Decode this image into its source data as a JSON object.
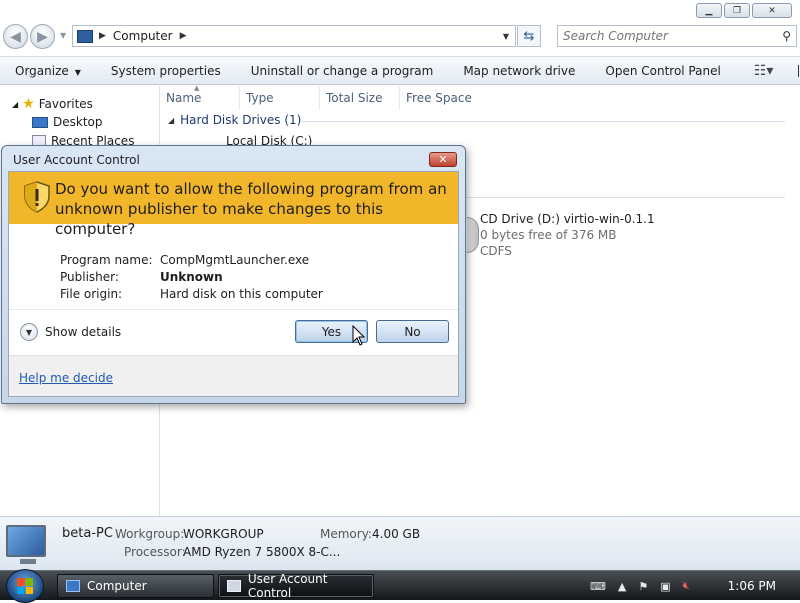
{
  "explorer": {
    "address": {
      "location": "Computer"
    },
    "search": {
      "placeholder": "Search Computer"
    },
    "toolbar": {
      "organize": "Organize",
      "system_properties": "System properties",
      "uninstall": "Uninstall or change a program",
      "map_drive": "Map network drive",
      "control_panel": "Open Control Panel"
    },
    "nav": {
      "favorites": "Favorites",
      "desktop": "Desktop",
      "recent": "Recent Places"
    },
    "columns": [
      "Name",
      "Type",
      "Total Size",
      "Free Space"
    ],
    "groups": {
      "hard_disk": "Hard Disk Drives (1)"
    },
    "local_disk": "Local Disk (C:)",
    "cd_drive": {
      "name": "CD Drive (D:) virtio-win-0.1.1",
      "free": "0 bytes free of 376 MB",
      "filesystem": "CDFS"
    },
    "details": {
      "name": "beta-PC",
      "workgroup_label": "Workgroup:",
      "workgroup": "WORKGROUP",
      "memory_label": "Memory:",
      "memory": "4.00 GB",
      "processor_label": "Processor:",
      "processor": "AMD Ryzen 7 5800X 8-C..."
    }
  },
  "uac": {
    "title": "User Account Control",
    "question": "Do you want to allow the following program from an unknown publisher to make changes to this computer?",
    "program_name_label": "Program name:",
    "program_name": "CompMgmtLauncher.exe",
    "publisher_label": "Publisher:",
    "publisher": "Unknown",
    "file_origin_label": "File origin:",
    "file_origin": "Hard disk on this computer",
    "show_details": "Show details",
    "yes": "Yes",
    "no": "No",
    "help_link": "Help me decide",
    "banner_color": "#f2b62b"
  },
  "taskbar": {
    "tasks": [
      "Computer",
      "User Account Control"
    ],
    "clock": "1:06 PM"
  }
}
